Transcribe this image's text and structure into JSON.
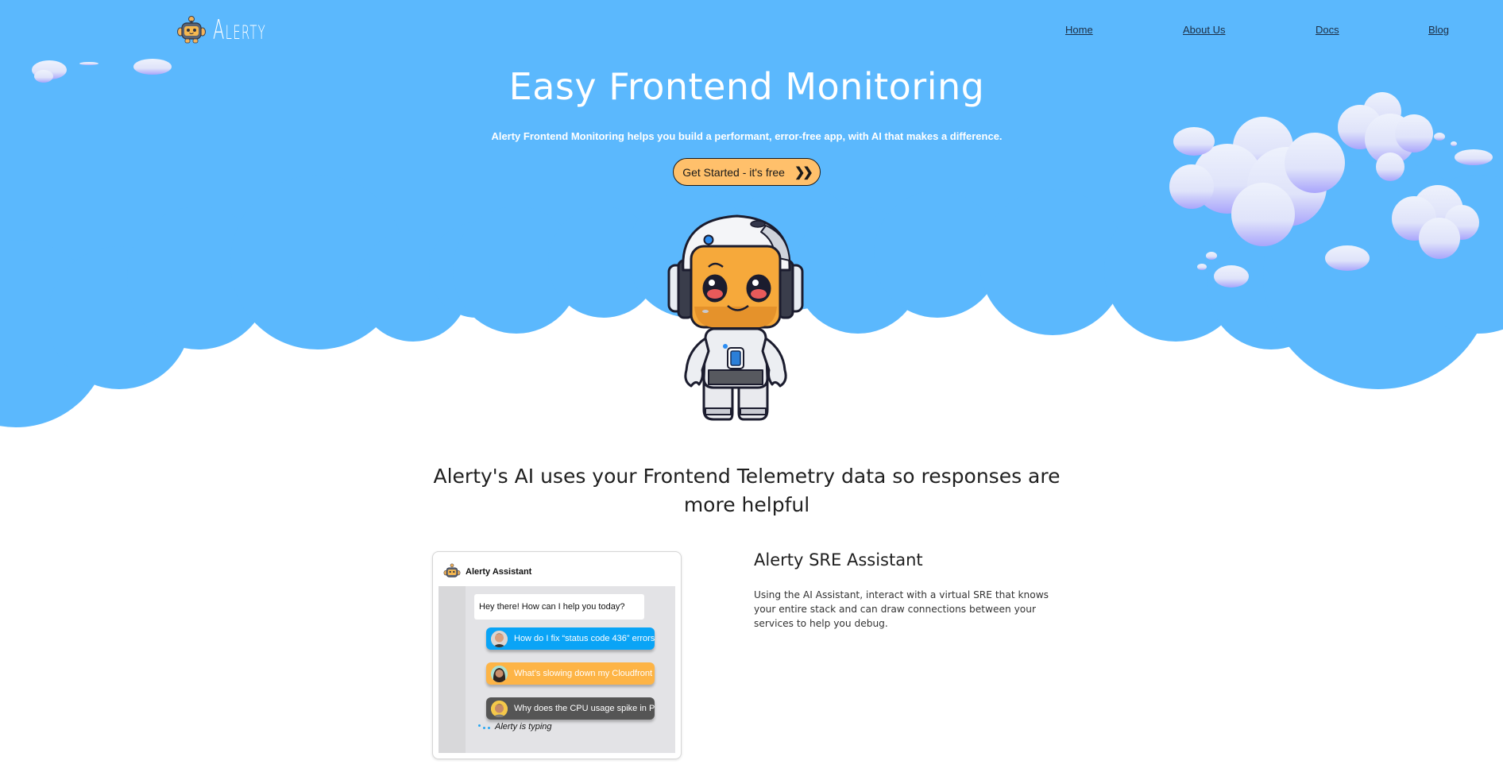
{
  "brand": {
    "name": "Alerty",
    "logo_icon": "robot-head-icon"
  },
  "nav": {
    "links": [
      {
        "label": "Home"
      },
      {
        "label": "About Us"
      },
      {
        "label": "Docs"
      },
      {
        "label": "Blog"
      }
    ]
  },
  "hero": {
    "title": "Easy Frontend Monitoring",
    "subtitle": "Alerty Frontend Monitoring helps you build a performant, error-free app, with AI that makes a difference.",
    "cta_label": "Get Started - it's free",
    "cta_icon": "double-chevron-right-icon",
    "mascot": "astronaut-robot-mascot",
    "colors": {
      "sky": "#5bb8fd",
      "cta": "#ffc06b",
      "cloud_light": "#e6ecfb",
      "cloud_shade": "#aeaafc"
    }
  },
  "feature_section": {
    "heading": "Alerty's AI uses your Frontend Telemetry data so responses are more helpful",
    "chat_mock": {
      "header_title": "Alerty Assistant",
      "bot_greeting": "Hey there! How can I help you today?",
      "user_messages": [
        {
          "text": "How do I fix “status code 436” errors",
          "color": "#0aa4f6"
        },
        {
          "text": "What’s slowing down my Cloudfront",
          "color": "#fdb446"
        },
        {
          "text": "Why does the CPU usage spike in Prod",
          "color": "#555555"
        }
      ],
      "typing_text": "Alerty is typing"
    },
    "feature": {
      "title": "Alerty SRE Assistant",
      "description": "Using the AI Assistant, interact with a virtual SRE that knows your entire stack and can draw connections between your services to help you debug."
    }
  }
}
